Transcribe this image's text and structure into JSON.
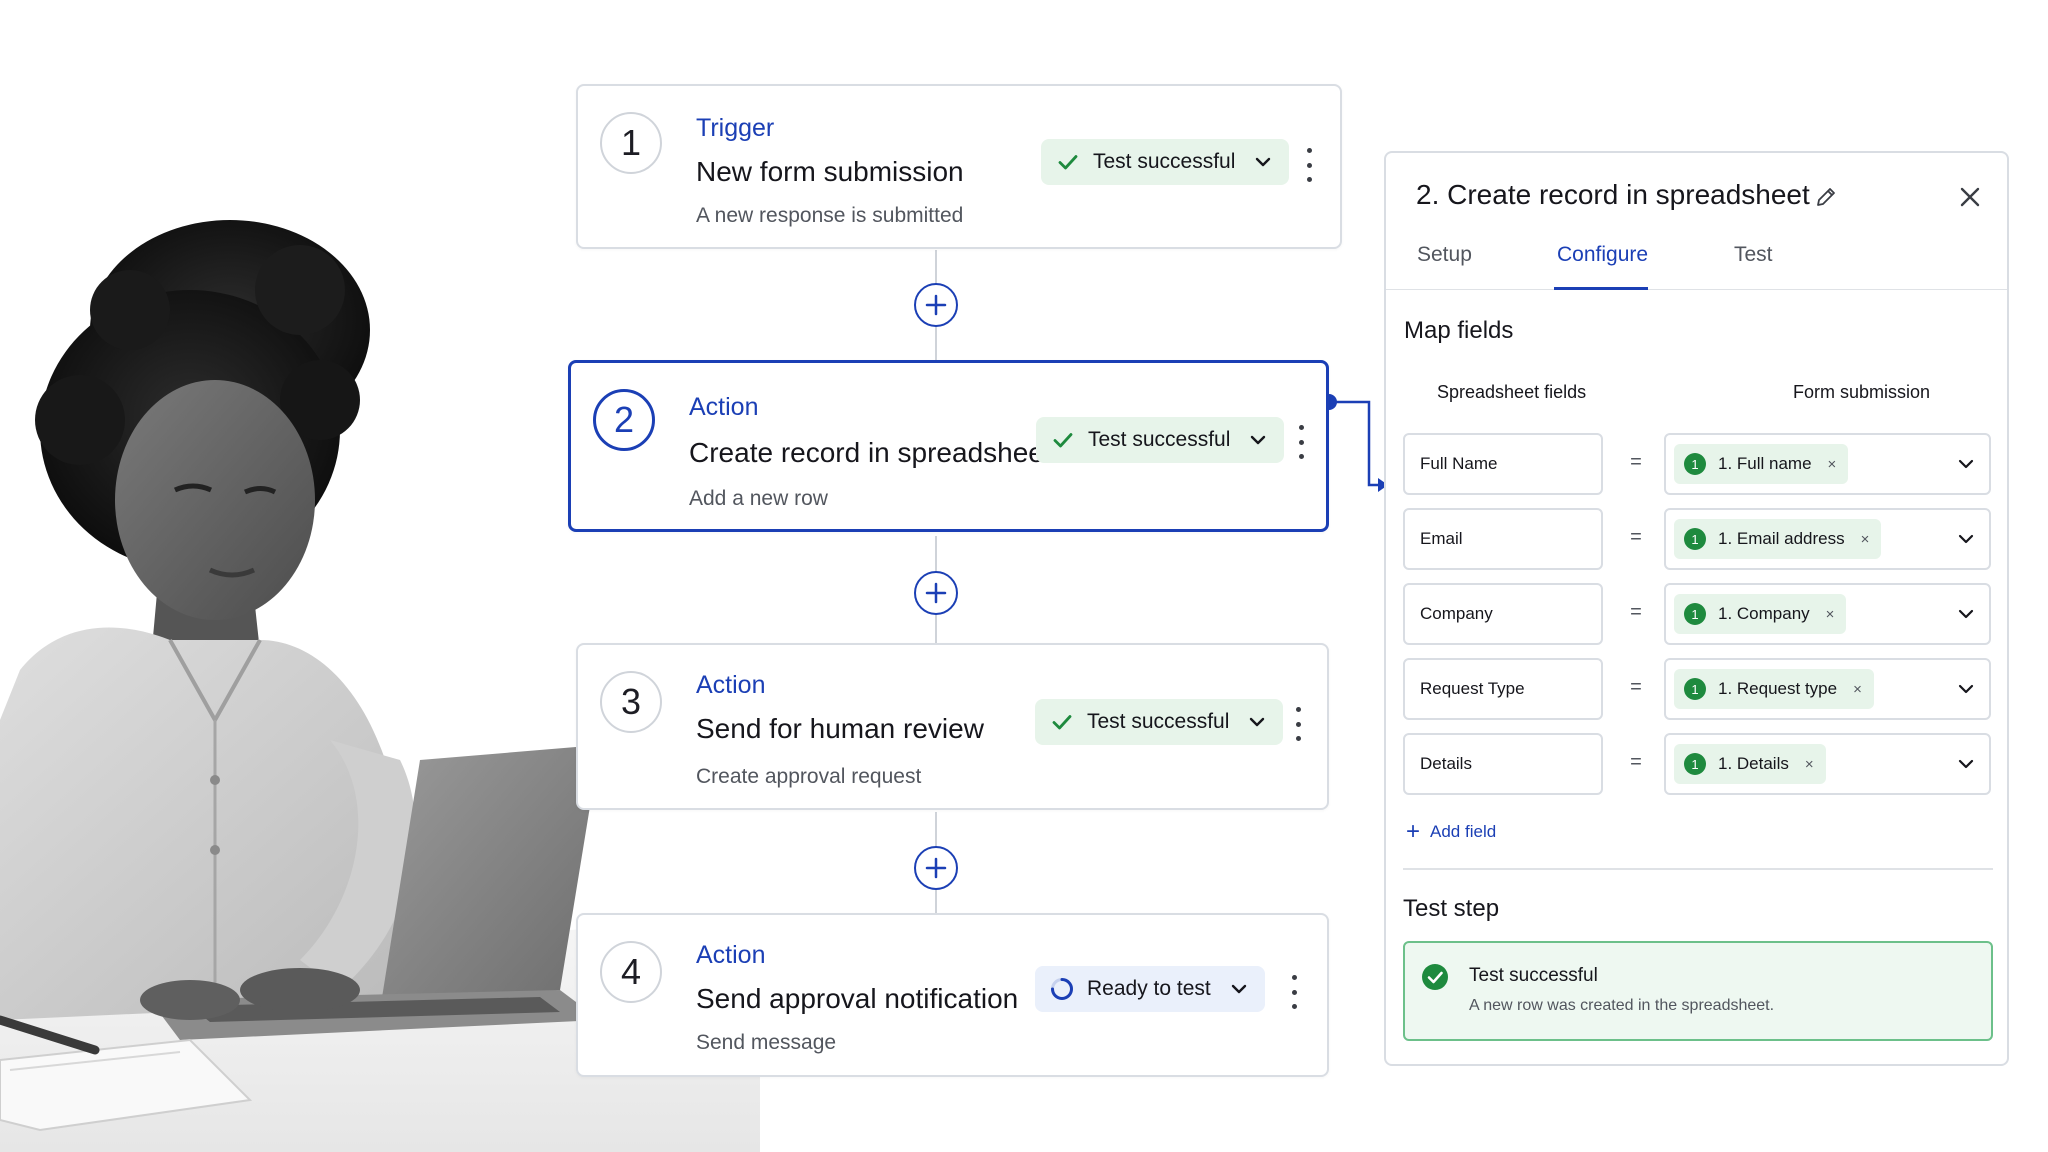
{
  "colors": {
    "accent": "#1b3fb5",
    "success": "#1e8a3e",
    "success_bg": "#e7f4ea",
    "pending_bg": "#eaf0fb",
    "border": "#d9dde3"
  },
  "steps": [
    {
      "number": "1",
      "kind": "Trigger",
      "title": "New form submission",
      "subtitle": "A new response is submitted",
      "status": "Test successful",
      "status_type": "success",
      "active": false
    },
    {
      "number": "2",
      "kind": "Action",
      "title": "Create record in spreadsheet",
      "subtitle": "Add a new row",
      "status": "Test successful",
      "status_type": "success",
      "active": true
    },
    {
      "number": "3",
      "kind": "Action",
      "title": "Send for human review",
      "subtitle": "Create approval request",
      "status": "Test successful",
      "status_type": "success",
      "active": false
    },
    {
      "number": "4",
      "kind": "Action",
      "title": "Send approval notification",
      "subtitle": "Send message",
      "status": "Ready to test",
      "status_type": "pending",
      "active": false
    }
  ],
  "icons": {
    "step_menu": "kebab-menu-icon",
    "add_step": "plus-icon",
    "status_ok": "check-icon",
    "status_pending": "spinner-icon",
    "status_dropdown": "chevron-down-icon"
  },
  "panel": {
    "title": "2.  Create record in spreadsheet",
    "tabs": [
      "Setup",
      "Configure",
      "Test"
    ],
    "active_tab": "Configure",
    "map_fields_heading": "Map fields",
    "col_left": "Spreadsheet fields",
    "col_right": "Form submission",
    "equals": "=",
    "mappings": [
      {
        "field": "Full Name",
        "badge": "1",
        "value": "1. Full name"
      },
      {
        "field": "Email",
        "badge": "1",
        "value": "1. Email address"
      },
      {
        "field": "Company",
        "badge": "1",
        "value": "1. Company"
      },
      {
        "field": "Request Type",
        "badge": "1",
        "value": "1. Request type"
      },
      {
        "field": "Details",
        "badge": "1",
        "value": "1. Details"
      }
    ],
    "chip_remove": "×",
    "add_field_label": "Add field",
    "test_heading": "Test step",
    "test_result_title": "Test successful",
    "test_result_desc": "A new row was created in the spreadsheet."
  }
}
